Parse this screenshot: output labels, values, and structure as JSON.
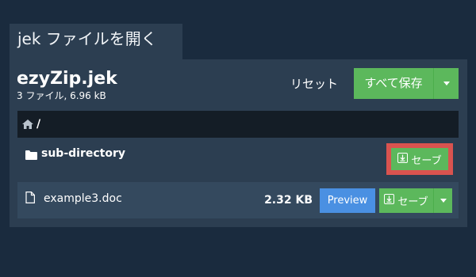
{
  "tab": {
    "title": "jek ファイルを開く"
  },
  "archive": {
    "name": "ezyZip.jek",
    "meta": "3 ファイル, 6.96 kB"
  },
  "toolbar": {
    "reset_label": "リセット",
    "save_all_label": "すべて保存"
  },
  "breadcrumb": {
    "separator": "/"
  },
  "entries": [
    {
      "type": "directory",
      "name": "sub-directory",
      "save_label": "セーブ"
    },
    {
      "type": "file",
      "name": "example3.doc",
      "size": "2.32 KB",
      "preview_label": "Preview",
      "save_label": "セーブ"
    }
  ],
  "colors": {
    "background": "#1a2b3e",
    "panel": "#2c3e51",
    "breadcrumb_bar": "#141d26",
    "success": "#5cb85c",
    "primary": "#4a90e2",
    "highlight": "#d9534f"
  },
  "icons": {
    "breadcrumb_root": "home-icon",
    "directory": "folder-icon",
    "file": "file-icon",
    "save": "download-icon",
    "dropdown": "chevron-down-icon"
  }
}
